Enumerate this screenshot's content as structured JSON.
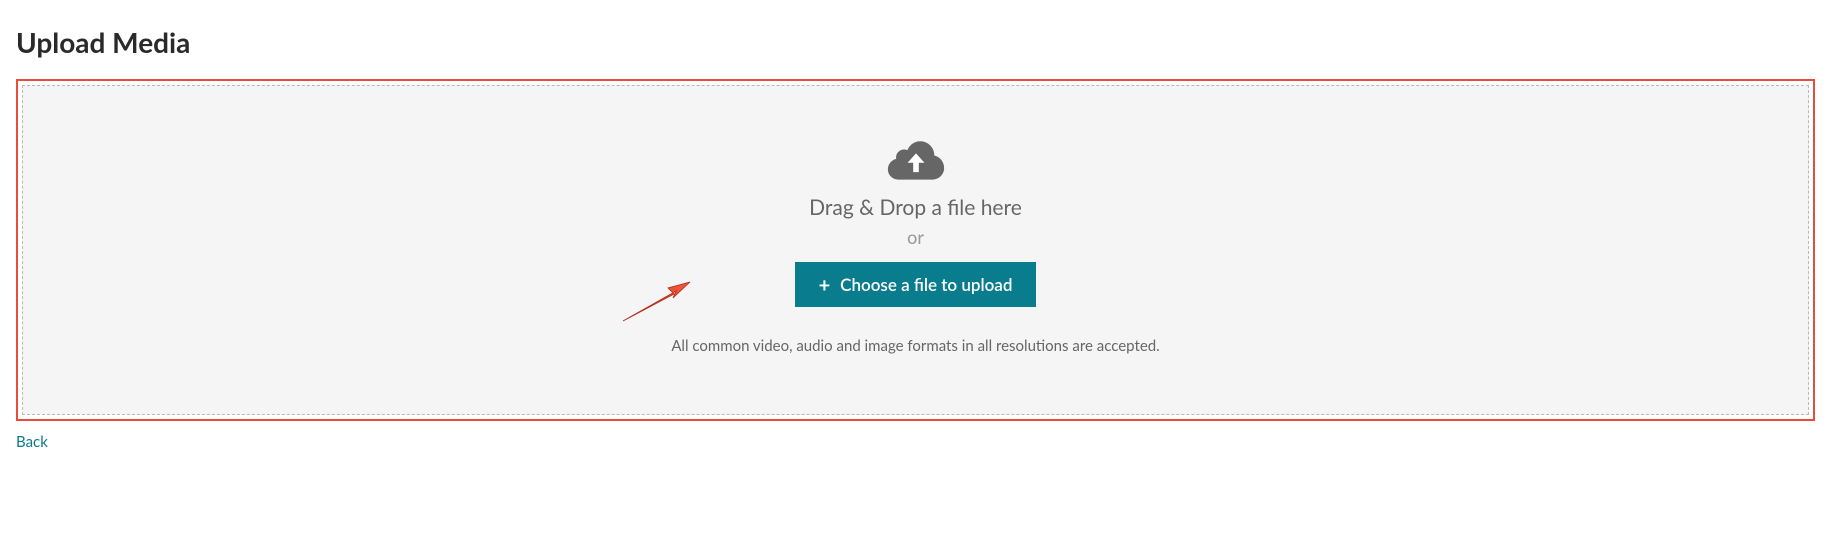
{
  "page": {
    "title": "Upload Media"
  },
  "dropzone": {
    "drag_text": "Drag & Drop a file here",
    "or_text": "or",
    "choose_button": "Choose a file to upload",
    "accept_text": "All common video, audio and image formats in all resolutions are accepted."
  },
  "nav": {
    "back": "Back"
  }
}
